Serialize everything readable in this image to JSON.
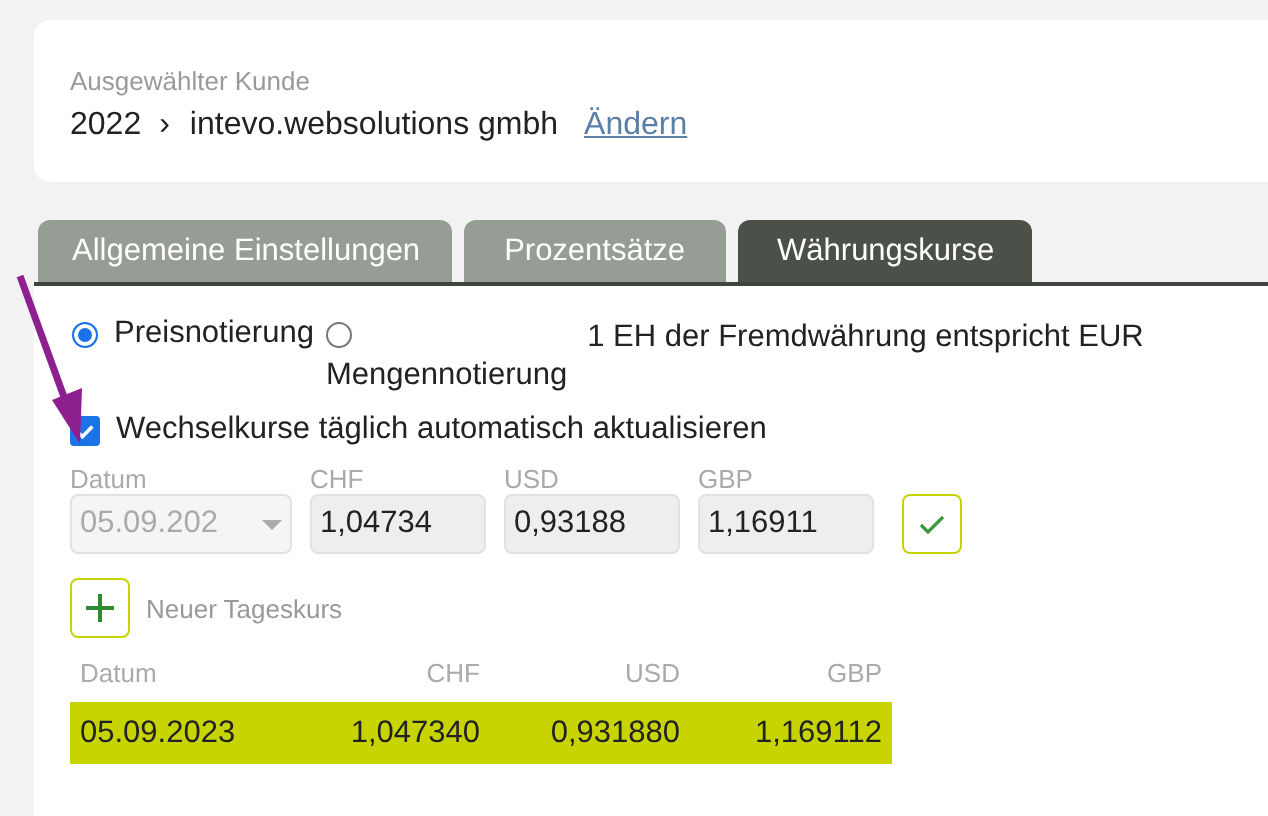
{
  "customer": {
    "label": "Ausgewählter Kunde",
    "year": "2022",
    "separator": "›",
    "name": "intevo.websolutions gmbh",
    "change_link": "Ändern"
  },
  "tabs": [
    {
      "label": "Allgemeine Einstellungen",
      "selected": false
    },
    {
      "label": "Prozentsätze",
      "selected": false
    },
    {
      "label": "Währungskurse",
      "selected": true
    }
  ],
  "notation": {
    "options": [
      {
        "label": "Preisnotierung",
        "selected": true
      },
      {
        "label": "Mengennotierung",
        "selected": false
      }
    ],
    "description": "1 EH der Fremdwährung entspricht EUR"
  },
  "auto_update": {
    "label": "Wechselkurse täglich automatisch aktualisieren",
    "checked": true
  },
  "entry_form": {
    "fields": [
      {
        "kind": "select",
        "label": "Datum",
        "value": "05.09.202",
        "disabled": true
      },
      {
        "kind": "input",
        "label": "CHF",
        "value": "1,04734",
        "disabled": false
      },
      {
        "kind": "input",
        "label": "USD",
        "value": "0,93188",
        "disabled": false
      },
      {
        "kind": "input",
        "label": "GBP",
        "value": "1,16911",
        "disabled": false
      }
    ]
  },
  "new_rate": {
    "label": "Neuer Tageskurs"
  },
  "table": {
    "columns": [
      "Datum",
      "CHF",
      "USD",
      "GBP"
    ],
    "rows": [
      {
        "cells": [
          "05.09.2023",
          "1,047340",
          "0,931880",
          "1,169112"
        ],
        "selected": true
      }
    ]
  }
}
